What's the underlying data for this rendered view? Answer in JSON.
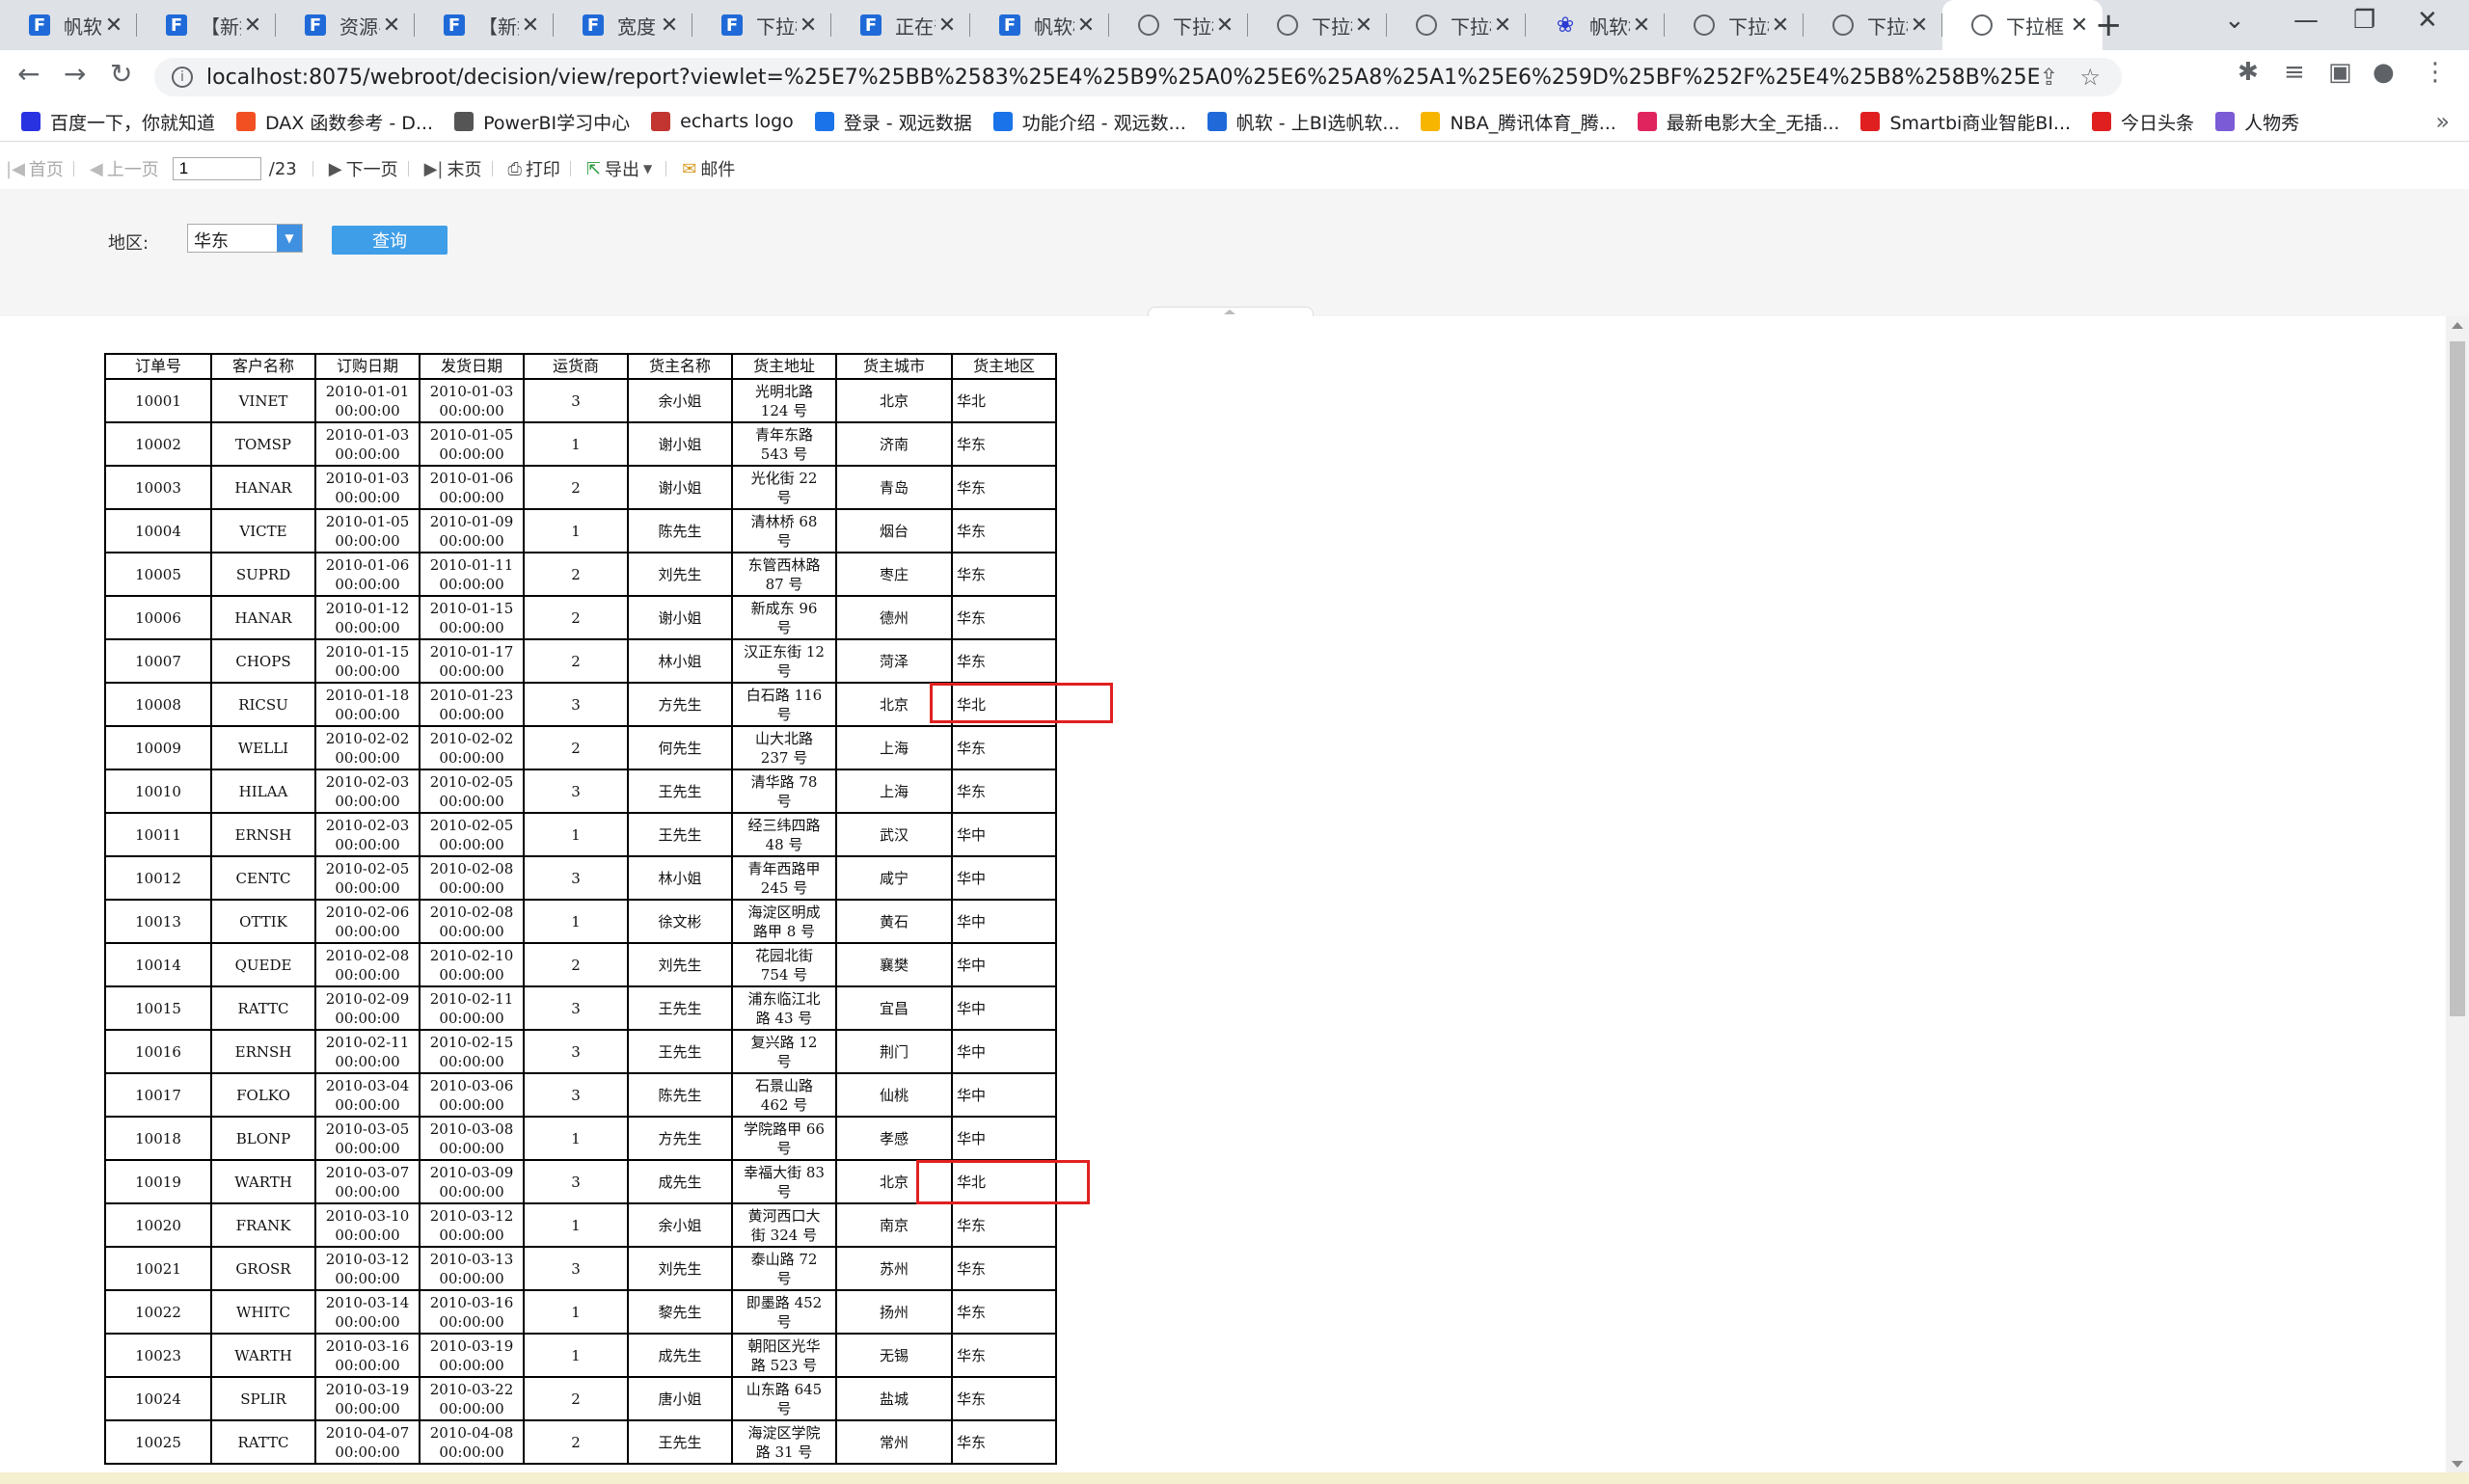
{
  "tabs": [
    {
      "icon": "fanruan-icon",
      "title": "帆软"
    },
    {
      "icon": "fanruan-icon",
      "title": "【新提"
    },
    {
      "icon": "fanruan-icon",
      "title": "资源导"
    },
    {
      "icon": "fanruan-icon",
      "title": "【新提"
    },
    {
      "icon": "fanruan-icon",
      "title": "宽度·"
    },
    {
      "icon": "fanruan-icon",
      "title": "下拉框"
    },
    {
      "icon": "fanruan-icon",
      "title": "正在部"
    },
    {
      "icon": "fanruan-icon",
      "title": "帆软框"
    },
    {
      "icon": "globe-icon",
      "title": "下拉框"
    },
    {
      "icon": "globe-icon",
      "title": "下拉框"
    },
    {
      "icon": "globe-icon",
      "title": "下拉框"
    },
    {
      "icon": "paw-icon",
      "title": "帆软框"
    },
    {
      "icon": "globe-icon",
      "title": "下拉框"
    },
    {
      "icon": "globe-icon",
      "title": "下拉框"
    },
    {
      "icon": "globe-icon",
      "title": "下拉框"
    }
  ],
  "address": {
    "url": "localhost:8075/webroot/decision/view/report?viewlet=%25E7%25BB%2583%25E4%25B9%25A0%25E6%25A8%25A1%25E6%259D%25BF%252F%25E4%25B8%258B%25E6%258B%2589%25E6%25..."
  },
  "bookmarks": [
    {
      "label": "百度一下，你就知道",
      "color": "#2932e1"
    },
    {
      "label": "DAX 函数参考 - D...",
      "color": "#f25022"
    },
    {
      "label": "PowerBI学习中心",
      "color": "#555555"
    },
    {
      "label": "echarts logo",
      "color": "#c23531"
    },
    {
      "label": "登录 - 观远数据",
      "color": "#1a73e8"
    },
    {
      "label": "功能介绍 - 观远数...",
      "color": "#1a73e8"
    },
    {
      "label": "帆软 - 上BI选帆软...",
      "color": "#1f6ad8"
    },
    {
      "label": "NBA_腾讯体育_腾...",
      "color": "#f7b500"
    },
    {
      "label": "最新电影大全_无插...",
      "color": "#e0245e"
    },
    {
      "label": "Smartbi商业智能BI...",
      "color": "#e02020"
    },
    {
      "label": "今日头条",
      "color": "#e02020"
    },
    {
      "label": "人物秀",
      "color": "#7b5cd6"
    }
  ],
  "report_toolbar": {
    "first": "首页",
    "prev": "上一页",
    "page": "1",
    "total": "/23",
    "next": "下一页",
    "last": "末页",
    "print": "打印",
    "export": "导出",
    "mail": "邮件"
  },
  "params": {
    "region_label": "地区:",
    "region_value": "华东",
    "query_button": "查询"
  },
  "table": {
    "headers": [
      "订单号",
      "客户名称",
      "订购日期",
      "发货日期",
      "运货商",
      "货主名称",
      "货主地址",
      "货主城市",
      "货主地区"
    ],
    "rows": [
      {
        "id": "10001",
        "cust": "VINET",
        "order_date": "2010-01-01",
        "order_time": "00:00:00",
        "ship_date": "2010-01-03",
        "ship_time": "00:00:00",
        "shipper": "3",
        "owner": "余小姐",
        "addr1": "光明北路",
        "addr2": "124 号",
        "city": "北京",
        "region": "华北"
      },
      {
        "id": "10002",
        "cust": "TOMSP",
        "order_date": "2010-01-03",
        "order_time": "00:00:00",
        "ship_date": "2010-01-05",
        "ship_time": "00:00:00",
        "shipper": "1",
        "owner": "谢小姐",
        "addr1": "青年东路",
        "addr2": "543 号",
        "city": "济南",
        "region": "华东"
      },
      {
        "id": "10003",
        "cust": "HANAR",
        "order_date": "2010-01-03",
        "order_time": "00:00:00",
        "ship_date": "2010-01-06",
        "ship_time": "00:00:00",
        "shipper": "2",
        "owner": "谢小姐",
        "addr1": "光化街 22",
        "addr2": "号",
        "city": "青岛",
        "region": "华东"
      },
      {
        "id": "10004",
        "cust": "VICTE",
        "order_date": "2010-01-05",
        "order_time": "00:00:00",
        "ship_date": "2010-01-09",
        "ship_time": "00:00:00",
        "shipper": "1",
        "owner": "陈先生",
        "addr1": "清林桥 68",
        "addr2": "号",
        "city": "烟台",
        "region": "华东"
      },
      {
        "id": "10005",
        "cust": "SUPRD",
        "order_date": "2010-01-06",
        "order_time": "00:00:00",
        "ship_date": "2010-01-11",
        "ship_time": "00:00:00",
        "shipper": "2",
        "owner": "刘先生",
        "addr1": "东管西林路",
        "addr2": "87 号",
        "city": "枣庄",
        "region": "华东"
      },
      {
        "id": "10006",
        "cust": "HANAR",
        "order_date": "2010-01-12",
        "order_time": "00:00:00",
        "ship_date": "2010-01-15",
        "ship_time": "00:00:00",
        "shipper": "2",
        "owner": "谢小姐",
        "addr1": "新成东 96",
        "addr2": "号",
        "city": "德州",
        "region": "华东"
      },
      {
        "id": "10007",
        "cust": "CHOPS",
        "order_date": "2010-01-15",
        "order_time": "00:00:00",
        "ship_date": "2010-01-17",
        "ship_time": "00:00:00",
        "shipper": "2",
        "owner": "林小姐",
        "addr1": "汉正东街 12",
        "addr2": "号",
        "city": "菏泽",
        "region": "华东"
      },
      {
        "id": "10008",
        "cust": "RICSU",
        "order_date": "2010-01-18",
        "order_time": "00:00:00",
        "ship_date": "2010-01-23",
        "ship_time": "00:00:00",
        "shipper": "3",
        "owner": "方先生",
        "addr1": "白石路 116",
        "addr2": "号",
        "city": "北京",
        "region": "华北"
      },
      {
        "id": "10009",
        "cust": "WELLI",
        "order_date": "2010-02-02",
        "order_time": "00:00:00",
        "ship_date": "2010-02-02",
        "ship_time": "00:00:00",
        "shipper": "2",
        "owner": "何先生",
        "addr1": "山大北路",
        "addr2": "237 号",
        "city": "上海",
        "region": "华东"
      },
      {
        "id": "10010",
        "cust": "HILAA",
        "order_date": "2010-02-03",
        "order_time": "00:00:00",
        "ship_date": "2010-02-05",
        "ship_time": "00:00:00",
        "shipper": "3",
        "owner": "王先生",
        "addr1": "清华路 78",
        "addr2": "号",
        "city": "上海",
        "region": "华东"
      },
      {
        "id": "10011",
        "cust": "ERNSH",
        "order_date": "2010-02-03",
        "order_time": "00:00:00",
        "ship_date": "2010-02-05",
        "ship_time": "00:00:00",
        "shipper": "1",
        "owner": "王先生",
        "addr1": "经三纬四路",
        "addr2": "48 号",
        "city": "武汉",
        "region": "华中"
      },
      {
        "id": "10012",
        "cust": "CENTC",
        "order_date": "2010-02-05",
        "order_time": "00:00:00",
        "ship_date": "2010-02-08",
        "ship_time": "00:00:00",
        "shipper": "3",
        "owner": "林小姐",
        "addr1": "青年西路甲",
        "addr2": "245 号",
        "city": "咸宁",
        "region": "华中"
      },
      {
        "id": "10013",
        "cust": "OTTIK",
        "order_date": "2010-02-06",
        "order_time": "00:00:00",
        "ship_date": "2010-02-08",
        "ship_time": "00:00:00",
        "shipper": "1",
        "owner": "徐文彬",
        "addr1": "海淀区明成",
        "addr2": "路甲 8 号",
        "city": "黄石",
        "region": "华中"
      },
      {
        "id": "10014",
        "cust": "QUEDE",
        "order_date": "2010-02-08",
        "order_time": "00:00:00",
        "ship_date": "2010-02-10",
        "ship_time": "00:00:00",
        "shipper": "2",
        "owner": "刘先生",
        "addr1": "花园北街",
        "addr2": "754 号",
        "city": "襄樊",
        "region": "华中"
      },
      {
        "id": "10015",
        "cust": "RATTC",
        "order_date": "2010-02-09",
        "order_time": "00:00:00",
        "ship_date": "2010-02-11",
        "ship_time": "00:00:00",
        "shipper": "3",
        "owner": "王先生",
        "addr1": "浦东临江北",
        "addr2": "路 43 号",
        "city": "宜昌",
        "region": "华中"
      },
      {
        "id": "10016",
        "cust": "ERNSH",
        "order_date": "2010-02-11",
        "order_time": "00:00:00",
        "ship_date": "2010-02-15",
        "ship_time": "00:00:00",
        "shipper": "3",
        "owner": "王先生",
        "addr1": "复兴路 12",
        "addr2": "号",
        "city": "荆门",
        "region": "华中"
      },
      {
        "id": "10017",
        "cust": "FOLKO",
        "order_date": "2010-03-04",
        "order_time": "00:00:00",
        "ship_date": "2010-03-06",
        "ship_time": "00:00:00",
        "shipper": "3",
        "owner": "陈先生",
        "addr1": "石景山路",
        "addr2": "462 号",
        "city": "仙桃",
        "region": "华中"
      },
      {
        "id": "10018",
        "cust": "BLONP",
        "order_date": "2010-03-05",
        "order_time": "00:00:00",
        "ship_date": "2010-03-08",
        "ship_time": "00:00:00",
        "shipper": "1",
        "owner": "方先生",
        "addr1": "学院路甲 66",
        "addr2": "号",
        "city": "孝感",
        "region": "华中"
      },
      {
        "id": "10019",
        "cust": "WARTH",
        "order_date": "2010-03-07",
        "order_time": "00:00:00",
        "ship_date": "2010-03-09",
        "ship_time": "00:00:00",
        "shipper": "3",
        "owner": "成先生",
        "addr1": "幸福大街 83",
        "addr2": "号",
        "city": "北京",
        "region": "华北"
      },
      {
        "id": "10020",
        "cust": "FRANK",
        "order_date": "2010-03-10",
        "order_time": "00:00:00",
        "ship_date": "2010-03-12",
        "ship_time": "00:00:00",
        "shipper": "1",
        "owner": "余小姐",
        "addr1": "黄河西口大",
        "addr2": "街 324 号",
        "city": "南京",
        "region": "华东"
      },
      {
        "id": "10021",
        "cust": "GROSR",
        "order_date": "2010-03-12",
        "order_time": "00:00:00",
        "ship_date": "2010-03-13",
        "ship_time": "00:00:00",
        "shipper": "3",
        "owner": "刘先生",
        "addr1": "泰山路 72",
        "addr2": "号",
        "city": "苏州",
        "region": "华东"
      },
      {
        "id": "10022",
        "cust": "WHITC",
        "order_date": "2010-03-14",
        "order_time": "00:00:00",
        "ship_date": "2010-03-16",
        "ship_time": "00:00:00",
        "shipper": "1",
        "owner": "黎先生",
        "addr1": "即墨路 452",
        "addr2": "号",
        "city": "扬州",
        "region": "华东"
      },
      {
        "id": "10023",
        "cust": "WARTH",
        "order_date": "2010-03-16",
        "order_time": "00:00:00",
        "ship_date": "2010-03-19",
        "ship_time": "00:00:00",
        "shipper": "1",
        "owner": "成先生",
        "addr1": "朝阳区光华",
        "addr2": "路 523 号",
        "city": "无锡",
        "region": "华东"
      },
      {
        "id": "10024",
        "cust": "SPLIR",
        "order_date": "2010-03-19",
        "order_time": "00:00:00",
        "ship_date": "2010-03-22",
        "ship_time": "00:00:00",
        "shipper": "2",
        "owner": "唐小姐",
        "addr1": "山东路 645",
        "addr2": "号",
        "city": "盐城",
        "region": "华东"
      },
      {
        "id": "10025",
        "cust": "RATTC",
        "order_date": "2010-04-07",
        "order_time": "00:00:00",
        "ship_date": "2010-04-08",
        "ship_time": "00:00:00",
        "shipper": "2",
        "owner": "王先生",
        "addr1": "海淀区学院",
        "addr2": "路 31 号",
        "city": "常州",
        "region": "华东"
      }
    ]
  }
}
